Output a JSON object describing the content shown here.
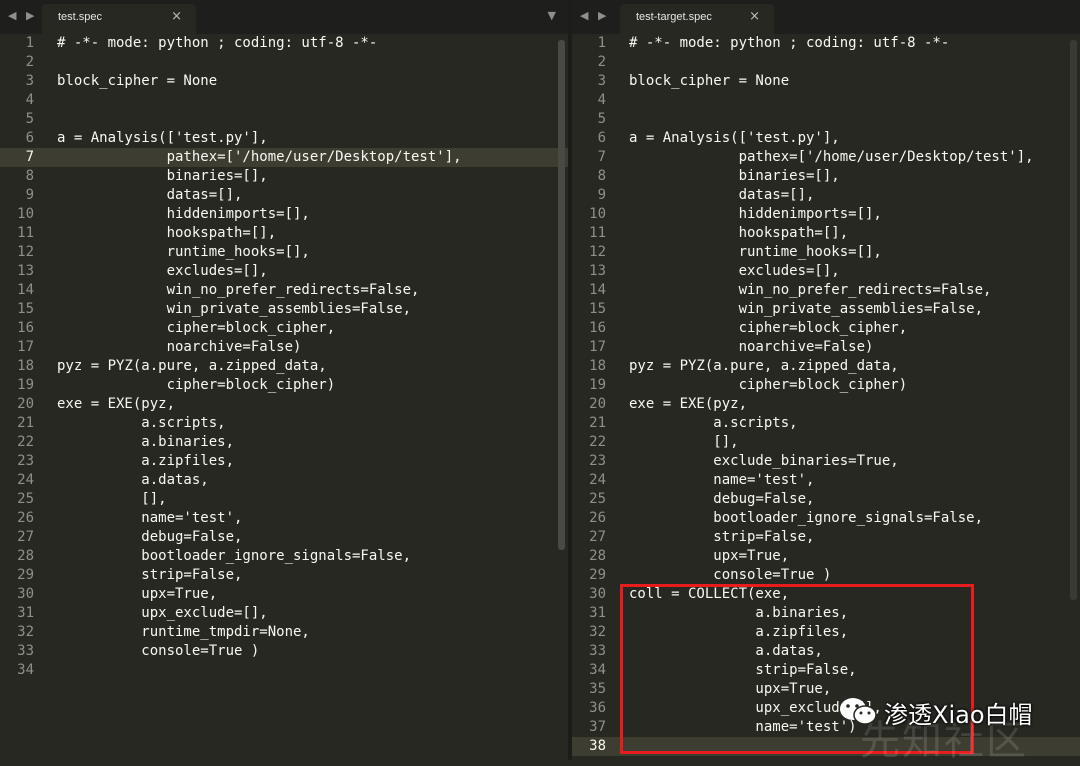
{
  "left_pane": {
    "nav_arrows": "◀ ▶",
    "tab_label": "test.spec",
    "tab_close": "×",
    "dropdown": "▼",
    "current_line": 7,
    "lines": [
      "# -*- mode: python ; coding: utf-8 -*-",
      "",
      "block_cipher = None",
      "",
      "",
      "a = Analysis(['test.py'],",
      "             pathex=['/home/user/Desktop/test'],",
      "             binaries=[],",
      "             datas=[],",
      "             hiddenimports=[],",
      "             hookspath=[],",
      "             runtime_hooks=[],",
      "             excludes=[],",
      "             win_no_prefer_redirects=False,",
      "             win_private_assemblies=False,",
      "             cipher=block_cipher,",
      "             noarchive=False)",
      "pyz = PYZ(a.pure, a.zipped_data,",
      "             cipher=block_cipher)",
      "exe = EXE(pyz,",
      "          a.scripts,",
      "          a.binaries,",
      "          a.zipfiles,",
      "          a.datas,",
      "          [],",
      "          name='test',",
      "          debug=False,",
      "          bootloader_ignore_signals=False,",
      "          strip=False,",
      "          upx=True,",
      "          upx_exclude=[],",
      "          runtime_tmpdir=None,",
      "          console=True )",
      ""
    ]
  },
  "right_pane": {
    "nav_arrows": "◀ ▶",
    "tab_label": "test-target.spec",
    "tab_close": "×",
    "current_line": 38,
    "lines": [
      "# -*- mode: python ; coding: utf-8 -*-",
      "",
      "block_cipher = None",
      "",
      "",
      "a = Analysis(['test.py'],",
      "             pathex=['/home/user/Desktop/test'],",
      "             binaries=[],",
      "             datas=[],",
      "             hiddenimports=[],",
      "             hookspath=[],",
      "             runtime_hooks=[],",
      "             excludes=[],",
      "             win_no_prefer_redirects=False,",
      "             win_private_assemblies=False,",
      "             cipher=block_cipher,",
      "             noarchive=False)",
      "pyz = PYZ(a.pure, a.zipped_data,",
      "             cipher=block_cipher)",
      "exe = EXE(pyz,",
      "          a.scripts,",
      "          [],",
      "          exclude_binaries=True,",
      "          name='test',",
      "          debug=False,",
      "          bootloader_ignore_signals=False,",
      "          strip=False,",
      "          upx=True,",
      "          console=True )",
      "coll = COLLECT(exe,",
      "               a.binaries,",
      "               a.zipfiles,",
      "               a.datas,",
      "               strip=False,",
      "               upx=True,",
      "               upx_exclude=[],",
      "               name='test')",
      ""
    ]
  },
  "watermark": {
    "badge_text": "渗透Xiao白帽",
    "background_text": "先知社区",
    "icon": "wechat-icon"
  },
  "colors": {
    "editor_bg": "#272822",
    "highlight_border": "#e81c1c"
  }
}
